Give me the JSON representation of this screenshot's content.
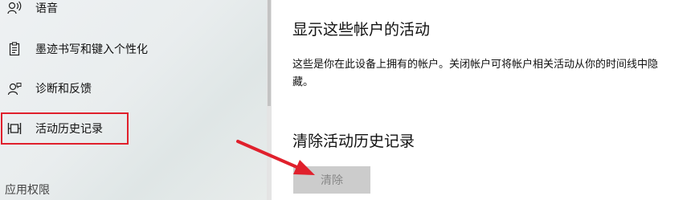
{
  "sidebar": {
    "items": [
      {
        "label": "语音",
        "icon": "speech-icon"
      },
      {
        "label": "墨迹书写和键入个性化",
        "icon": "clipboard-icon"
      },
      {
        "label": "诊断和反馈",
        "icon": "feedback-person-icon"
      },
      {
        "label": "活动历史记录",
        "icon": "timeline-icon"
      }
    ],
    "section_label": "应用权限"
  },
  "main": {
    "accounts_heading": "显示这些帐户的活动",
    "accounts_description": "这些是你在此设备上拥有的帐户。关闭帐户可将帐户相关活动从你的时间线中隐藏。",
    "clear_heading": "清除活动历史记录",
    "clear_button": "清除"
  },
  "annotations": {
    "highlight_color": "#e0202c",
    "arrow_color": "#e0202c"
  }
}
